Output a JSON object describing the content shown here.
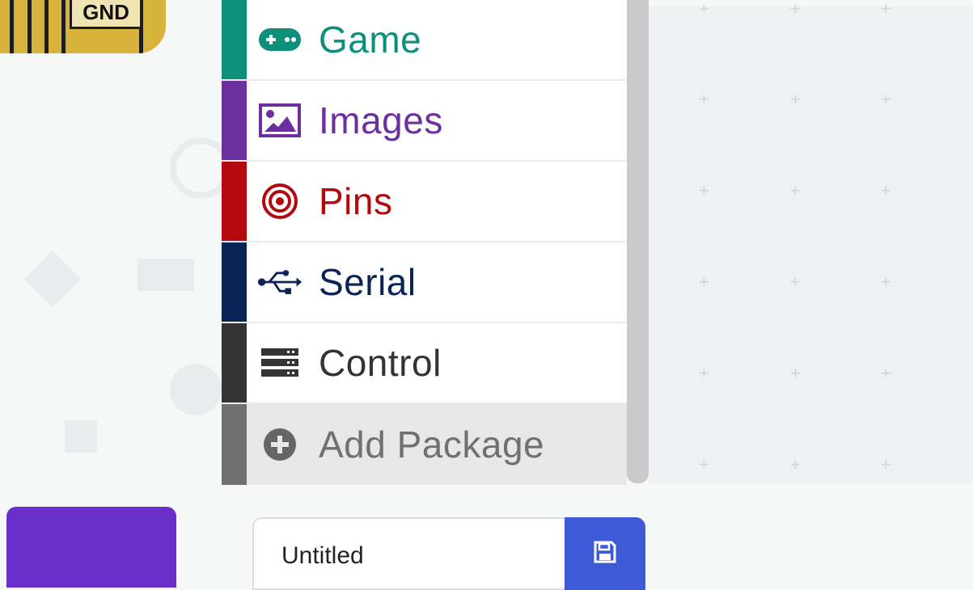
{
  "header_card": {
    "label": "GND",
    "color": "#d8b33c"
  },
  "toolbox": {
    "categories": [
      {
        "id": "game",
        "label": "Game",
        "color": "#0e8f7b",
        "icon": "gamepad-icon"
      },
      {
        "id": "images",
        "label": "Images",
        "color": "#6b2f9e",
        "icon": "image-icon"
      },
      {
        "id": "pins",
        "label": "Pins",
        "color": "#b3090e",
        "icon": "target-icon"
      },
      {
        "id": "serial",
        "label": "Serial",
        "color": "#0c2357",
        "icon": "usb-icon"
      },
      {
        "id": "control",
        "label": "Control",
        "color": "#333333",
        "icon": "server-icon"
      },
      {
        "id": "add",
        "label": "Add Package",
        "color": "#707070",
        "icon": "plus-circle-icon"
      }
    ]
  },
  "project": {
    "name_value": "Untitled",
    "save_icon": "save-icon",
    "save_color": "#3f5ad6"
  },
  "accent_purple": "#6a2fc8"
}
